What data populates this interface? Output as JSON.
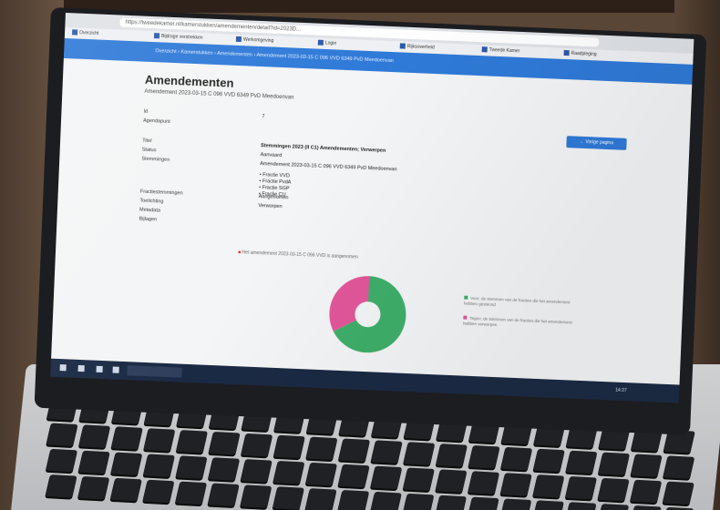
{
  "browser": {
    "url": "https://tweedekamer.nl/kamerstukken/amendementen/detail?id=2023D...",
    "bookmarks": [
      "Overzicht",
      "Bijdrage verstrekken",
      "Werkomgeving",
      "Login",
      "Rijksoverheid",
      "Tweede Kamer",
      "Raadpleging"
    ]
  },
  "navbar": {
    "breadcrumb": "Overzicht › Kamerstukken › Amendementen › Amendement 2023-03-15 C 096 VVD 6349 PvD Meedoenvan"
  },
  "page": {
    "title": "Amendementen",
    "subtitle": "Amendement 2023-03-15 C 096 VVD 6349 PvD Meedoenvan",
    "button_label": "Vorige pagina"
  },
  "details": [
    {
      "label": "Id",
      "value": "7"
    },
    {
      "label": "Agendapunt",
      "value": ""
    },
    {
      "label": "Titel",
      "value": "Stemmingen 2023 (II C1) Amendementen; Verwerpen"
    },
    {
      "label": "Status",
      "value": "Aanvaard"
    },
    {
      "label": "Stemmingen",
      "value": "Amendement 2023-03-15 C 096 VVD 6349 PvD Meedoenvan"
    },
    {
      "label": "Fractiestemmingen",
      "value": "Aangenomen"
    },
    {
      "label": "Toelichting",
      "value": "Verworpen"
    },
    {
      "label": "Metadata",
      "value": ""
    },
    {
      "label": "Bijlagen",
      "value": ""
    }
  ],
  "factions": [
    "Fractie VVD",
    "Fractie PvdA",
    "Fractie SGP",
    "Fractie CU"
  ],
  "warning": "Het amendement 2023-03-15 C 096 VVD is aangenomen",
  "chart_data": {
    "type": "pie",
    "categories": [
      "Voor",
      "Tegen"
    ],
    "values": [
      67,
      33
    ],
    "colors": [
      "#3fae6a",
      "#e2579a"
    ],
    "title": ""
  },
  "legend_text": [
    "Voor: de stemmen van de fracties die het amendement hebben gesteund",
    "Tegen: de stemmen van de fracties die het amendement hebben verworpen"
  ],
  "taskbar": {
    "clock": "14:27"
  }
}
